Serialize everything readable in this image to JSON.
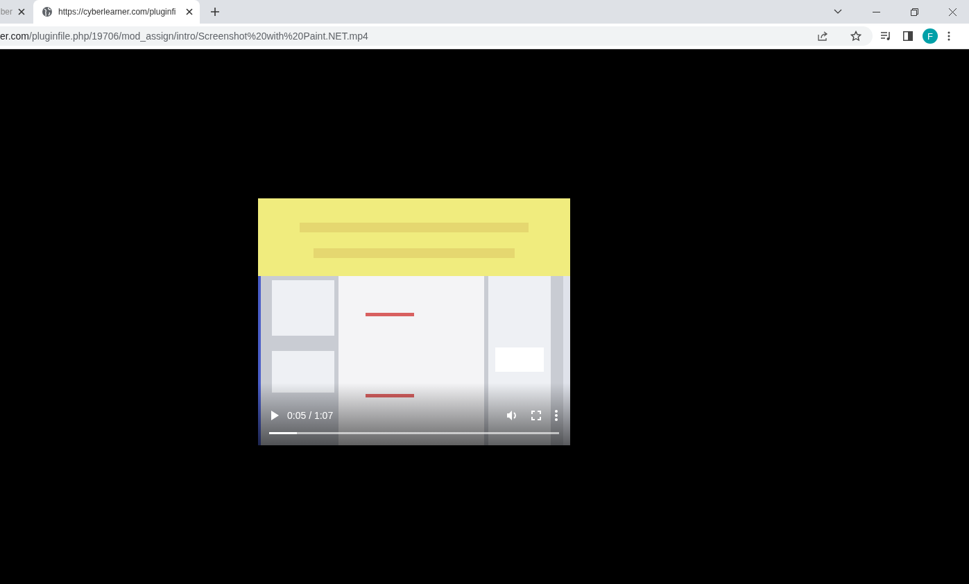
{
  "tabs": [
    {
      "title": "ber",
      "selected": false
    },
    {
      "title": "https://cyberlearner.com/pluginfi",
      "selected": true
    }
  ],
  "address_bar": {
    "host": "er.com",
    "path": "/pluginfile.php/19706/mod_assign/intro/Screenshot%20with%20Paint.NET.mp4"
  },
  "profile": {
    "initial": "F"
  },
  "video": {
    "time": "0:05 / 1:07",
    "playing": false,
    "progress": {
      "level": 0.096
    }
  }
}
